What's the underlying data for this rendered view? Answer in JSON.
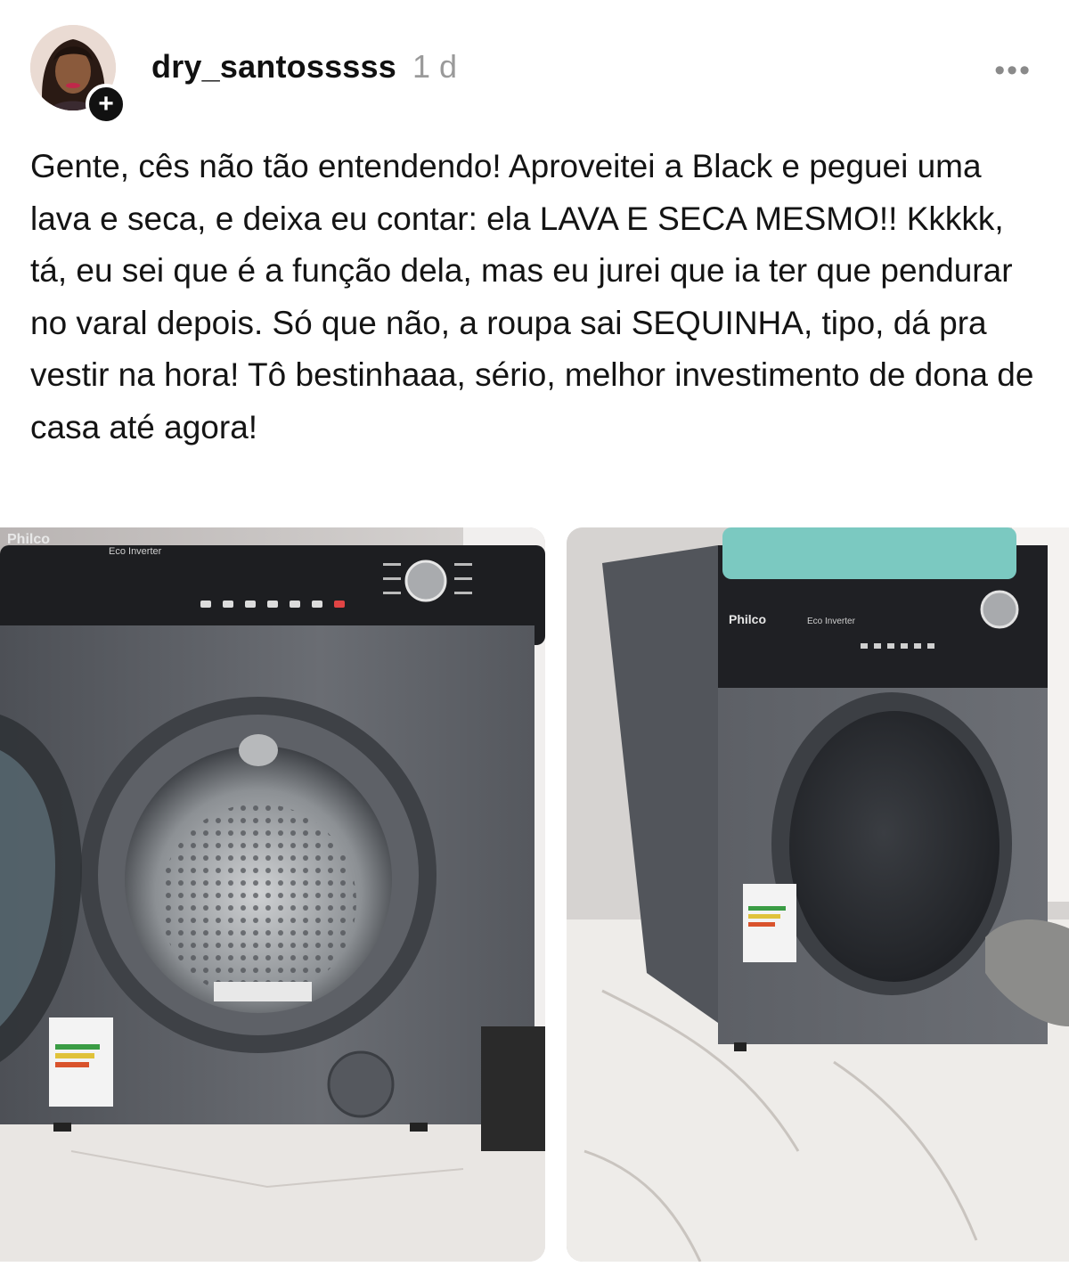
{
  "post": {
    "username": "dry_santosssss",
    "timestamp": "1 d",
    "follow_symbol": "+",
    "more_symbol": "•••",
    "text": "Gente, cês não tão entendendo! Aproveitei a Black e peguei uma lava e seca, e deixa eu contar: ela LAVA E SECA MESMO!! Kkkkk, tá, eu sei que é a função dela, mas eu jurei que ia ter que pendurar no varal depois. Só que não, a roupa sai SEQUINHA, tipo, dá pra vestir na hora! Tô bestinhaaa, sério, melhor investimento de dona de casa até agora!"
  },
  "photos": {
    "left": {
      "brand": "Philco",
      "subbrand": "Eco Inverter"
    },
    "right": {
      "brand": "Philco",
      "subbrand": "Eco Inverter"
    }
  },
  "icons": [
    "avatar-photo",
    "plus-icon",
    "more-dots-icon"
  ],
  "colors": {
    "text": "#141414",
    "muted": "#9a9a9a",
    "background": "#ffffff",
    "machine": "#5b5e64"
  }
}
